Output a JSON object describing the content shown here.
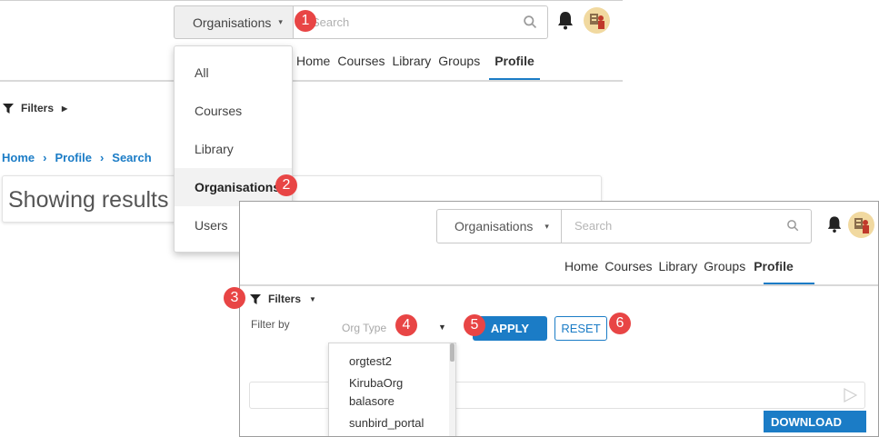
{
  "background_screen": {
    "header": {
      "category_selector": {
        "label": "Organisations",
        "caret": "▾"
      },
      "search": {
        "placeholder": "Search"
      }
    },
    "nav": {
      "items": [
        "Home",
        "Courses",
        "Library",
        "Groups",
        "Profile"
      ],
      "active": "Profile"
    },
    "filters": {
      "label": "Filters",
      "state": "collapsed"
    },
    "breadcrumb": [
      "Home",
      "Profile",
      "Search"
    ],
    "results_heading": "Showing results '",
    "category_dropdown": {
      "options": [
        "All",
        "Courses",
        "Library",
        "Organisations",
        "Users"
      ],
      "selected": "Organisations"
    }
  },
  "foreground_screen": {
    "header": {
      "category_selector": {
        "label": "Organisations",
        "caret": "▾"
      },
      "search": {
        "placeholder": "Search"
      }
    },
    "nav": {
      "items": [
        "Home",
        "Courses",
        "Library",
        "Groups",
        "Profile"
      ],
      "active": "Profile"
    },
    "filters": {
      "label": "Filters",
      "state": "expanded",
      "filter_by_label": "Filter by",
      "org_type_placeholder": "Org Type",
      "apply_label": "APPLY",
      "reset_label": "RESET",
      "org_type_options": [
        "orgtest2",
        "KirubaOrg",
        "balasore",
        "sunbird_portal"
      ]
    },
    "download_label": "DOWNLOAD"
  },
  "callouts": [
    "1",
    "2",
    "3",
    "4",
    "5",
    "6"
  ],
  "colors": {
    "accent_blue": "#1b7cc6",
    "callout_red": "#e84545",
    "selected_bg": "#f2f2f2"
  },
  "icons": [
    "search-icon",
    "bell-icon",
    "avatar",
    "filter-funnel-icon",
    "chevron-right-icon",
    "send-icon"
  ]
}
